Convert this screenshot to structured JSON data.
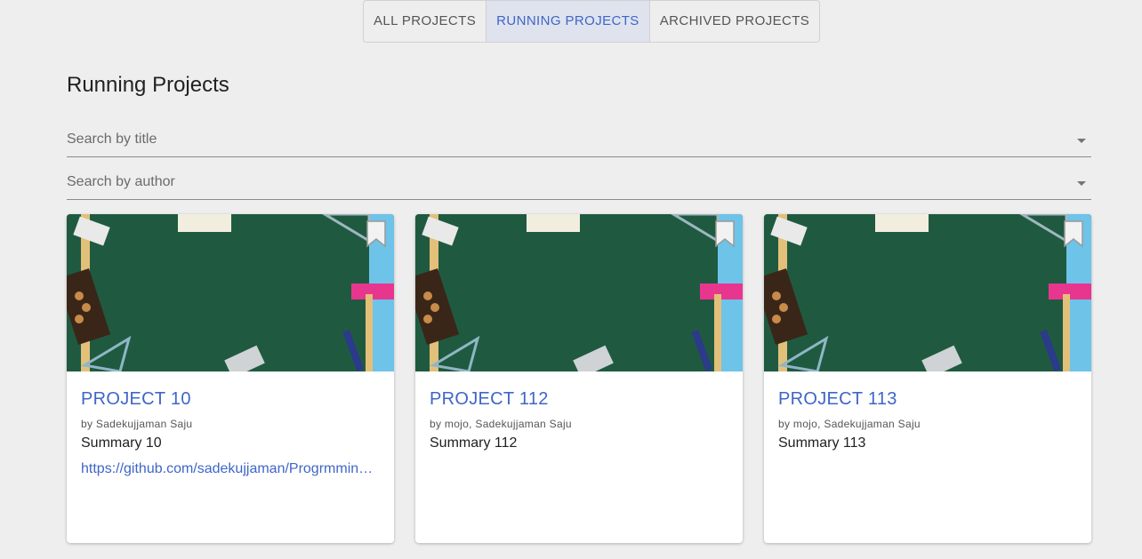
{
  "tabs": [
    {
      "label": "ALL PROJECTS",
      "active": false
    },
    {
      "label": "RUNNING PROJECTS",
      "active": true
    },
    {
      "label": "ARCHIVED PROJECTS",
      "active": false
    }
  ],
  "page_title": "Running Projects",
  "filters": {
    "title_placeholder": "Search by title",
    "author_placeholder": "Search by author"
  },
  "cards": [
    {
      "title": "PROJECT 10",
      "authors": "by Sadekujjaman Saju",
      "summary": "Summary 10",
      "link": "https://github.com/sadekujjaman/Progrmming-Contest",
      "icon": "bookmark-icon"
    },
    {
      "title": "PROJECT 112",
      "authors": "by mojo, Sadekujjaman Saju",
      "summary": "Summary 112",
      "link": "",
      "icon": "bookmark-icon"
    },
    {
      "title": "PROJECT 113",
      "authors": "by mojo, Sadekujjaman Saju",
      "summary": "Summary 113",
      "link": "",
      "icon": "bookmark-icon"
    }
  ],
  "colors": {
    "accent": "#3f65c8",
    "background": "#eeeeee",
    "active_tab_bg": "#dfe3ee",
    "chalkboard": "#1f5a40"
  }
}
